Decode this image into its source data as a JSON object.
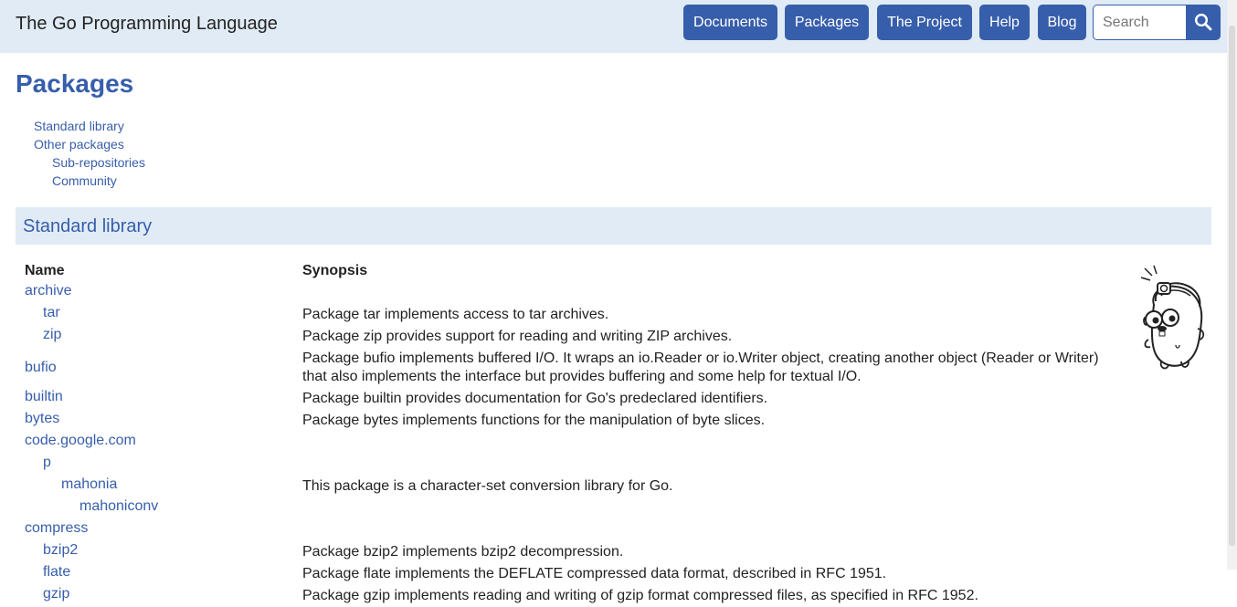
{
  "header": {
    "site_title": "The Go Programming Language",
    "nav": [
      "Documents",
      "Packages",
      "The Project",
      "Help",
      "Blog"
    ],
    "search_placeholder": "Search"
  },
  "page": {
    "title": "Packages",
    "toc": [
      "Standard library",
      "Other packages",
      "Sub-repositories",
      "Community"
    ],
    "section_title": "Standard library"
  },
  "table": {
    "headers": [
      "Name",
      "Synopsis"
    ],
    "rows": [
      {
        "name": "archive",
        "indent": 0,
        "synopsis": ""
      },
      {
        "name": "tar",
        "indent": 1,
        "synopsis": "Package tar implements access to tar archives."
      },
      {
        "name": "zip",
        "indent": 1,
        "synopsis": "Package zip provides support for reading and writing ZIP archives."
      },
      {
        "name": "bufio",
        "indent": 0,
        "synopsis": "Package bufio implements buffered I/O. It wraps an io.Reader or io.Writer object, creating another object (Reader or Writer) that also implements the interface but provides buffering and some help for textual I/O."
      },
      {
        "name": "builtin",
        "indent": 0,
        "synopsis": "Package builtin provides documentation for Go's predeclared identifiers."
      },
      {
        "name": "bytes",
        "indent": 0,
        "synopsis": "Package bytes implements functions for the manipulation of byte slices."
      },
      {
        "name": "code.google.com",
        "indent": 0,
        "synopsis": ""
      },
      {
        "name": "p",
        "indent": 1,
        "synopsis": ""
      },
      {
        "name": "mahonia",
        "indent": 2,
        "synopsis": "This package is a character-set conversion library for Go."
      },
      {
        "name": "mahoniconv",
        "indent": 3,
        "synopsis": ""
      },
      {
        "name": "compress",
        "indent": 0,
        "synopsis": ""
      },
      {
        "name": "bzip2",
        "indent": 1,
        "synopsis": "Package bzip2 implements bzip2 decompression."
      },
      {
        "name": "flate",
        "indent": 1,
        "synopsis": "Package flate implements the DEFLATE compressed data format, described in RFC 1951."
      },
      {
        "name": "gzip",
        "indent": 1,
        "synopsis": "Package gzip implements reading and writing of gzip format compressed files, as specified in RFC 1952."
      }
    ]
  },
  "icons": {
    "search": "search-icon",
    "mascot": "gopher-mascot-icon"
  },
  "colors": {
    "accent": "#375eab",
    "header_bg": "#e0ebf5",
    "text": "#222222"
  }
}
